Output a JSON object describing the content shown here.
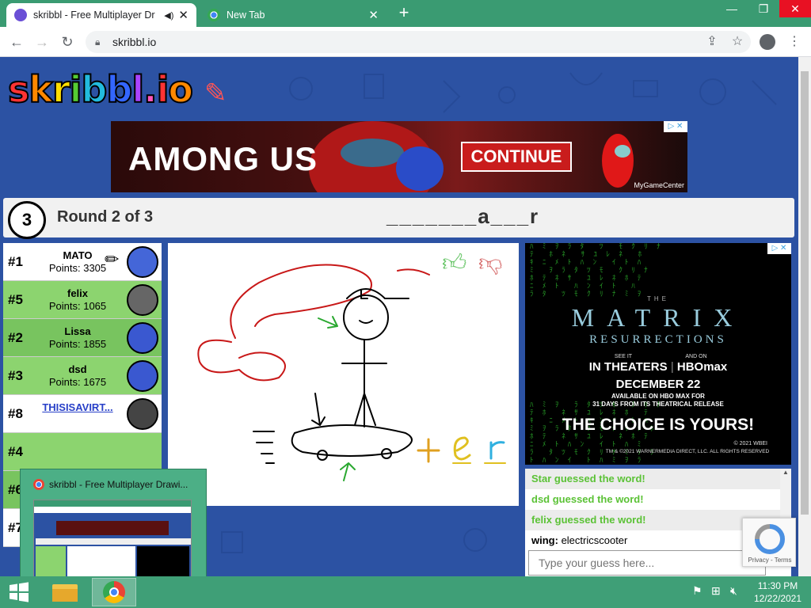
{
  "browser": {
    "tabs": [
      {
        "title": "skribbl - Free Multiplayer Dr",
        "active": true
      },
      {
        "title": "New Tab",
        "active": false
      }
    ],
    "url": "skribbl.io"
  },
  "game": {
    "logo": "skribbl.io",
    "round_timer": "3",
    "round_text": "Round 2 of 3",
    "word_hint": "_______a___r",
    "players": [
      {
        "rank": "#1",
        "name": "MATO",
        "points": "Points: 3305",
        "bg": "white"
      },
      {
        "rank": "#5",
        "name": "felix",
        "points": "Points: 1065",
        "bg": "green"
      },
      {
        "rank": "#2",
        "name": "Lissa",
        "points": "Points: 1855",
        "bg": "green2"
      },
      {
        "rank": "#3",
        "name": "dsd",
        "points": "Points: 1675",
        "bg": "green"
      },
      {
        "rank": "#8",
        "name": "THISISAVIRT...",
        "points": "",
        "bg": "white"
      }
    ],
    "hidden_ranks": [
      "#4",
      "#6",
      "#7"
    ],
    "canvas_letters": "+ e r",
    "chat": [
      {
        "type": "guess",
        "text": "Star guessed the word!"
      },
      {
        "type": "guess",
        "text": "dsd guessed the word!"
      },
      {
        "type": "guess",
        "text": "felix guessed the word!"
      },
      {
        "type": "message",
        "user": "wing:",
        "text": "electricscooter"
      }
    ],
    "chat_placeholder": "Type your guess here..."
  },
  "ads": {
    "top": {
      "title": "AMONG US",
      "button": "CONTINUE",
      "brand": "MyGameCenter"
    },
    "side": {
      "pre": "THE",
      "title": "MATRIX",
      "subtitle": "RESURRECTIONS",
      "see_it": "SEE IT",
      "and_on": "AND ON",
      "in_theaters": "IN THEATERS",
      "hbo": "HBOmax",
      "date": "DECEMBER 22",
      "available": "AVAILABLE ON HBO MAX FOR",
      "days": "31 DAYS FROM ITS THEATRICAL RELEASE",
      "tagline": "THE CHOICE IS YOURS!",
      "copyright1": "© 2021 WBEI",
      "copyright2": "TM & ©2021 WARNERMEDIA DIRECT, LLC. ALL RIGHTS RESERVED"
    }
  },
  "recaptcha": {
    "label": "Privacy - Terms"
  },
  "thumbnail": {
    "title": "skribbl - Free Multiplayer Drawi..."
  },
  "taskbar": {
    "time": "11:30 PM",
    "date": "12/22/2021"
  },
  "colors": {
    "tabbar": "#3a9b72",
    "page_bg": "#2c52a3",
    "guess_green": "#5bc236"
  }
}
